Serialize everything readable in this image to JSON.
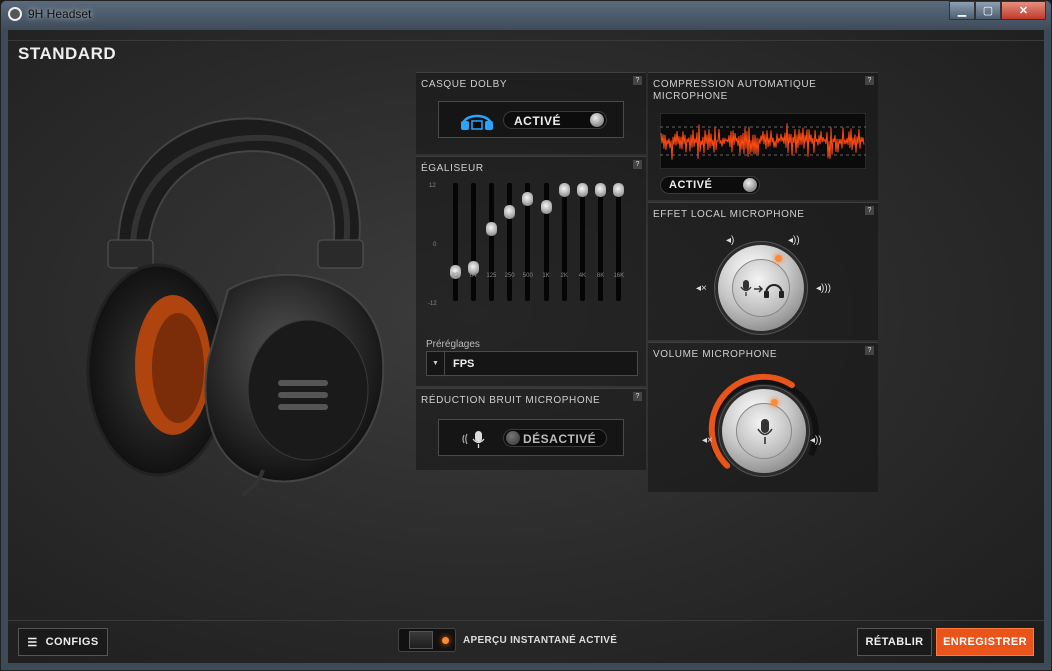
{
  "window": {
    "title": "9H Headset",
    "min_label": "▁",
    "max_label": "▢",
    "close_label": "✕"
  },
  "page": {
    "title": "STANDARD"
  },
  "dolby": {
    "title": "CASQUE DOLBY",
    "state": "ACTIVÉ",
    "help": "?"
  },
  "equalizer": {
    "title": "ÉGALISEUR",
    "help": "?",
    "scale_top": "12",
    "scale_mid": "0",
    "scale_bottom": "-12",
    "bands": [
      {
        "freq": "32",
        "gain_db": -7
      },
      {
        "freq": "64",
        "gain_db": -6
      },
      {
        "freq": "125",
        "gain_db": 3
      },
      {
        "freq": "250",
        "gain_db": 7
      },
      {
        "freq": "500",
        "gain_db": 10
      },
      {
        "freq": "1K",
        "gain_db": 8
      },
      {
        "freq": "2K",
        "gain_db": 13
      },
      {
        "freq": "4K",
        "gain_db": 13
      },
      {
        "freq": "8K",
        "gain_db": 13
      },
      {
        "freq": "16K",
        "gain_db": 13
      }
    ],
    "presets_label": "Préréglages",
    "preset_value": "FPS"
  },
  "noise_reduction": {
    "title": "RÉDUCTION BRUIT MICROPHONE",
    "state": "DÉSACTIVÉ",
    "help": "?"
  },
  "compression": {
    "title_line1": "COMPRESSION AUTOMATIQUE",
    "title_line2": "MICROPHONE",
    "state": "ACTIVÉ",
    "help": "?"
  },
  "sidetone": {
    "title": "EFFET LOCAL MICROPHONE",
    "help": "?"
  },
  "mic_volume": {
    "title": "VOLUME MICROPHONE",
    "help": "?",
    "level": 0.62
  },
  "bottom": {
    "configs_label": "CONFIGS",
    "preview_label": "APERÇU INSTANTANÉ ACTIVÉ",
    "reset_label": "RÉTABLIR",
    "save_label": "ENREGISTRER"
  },
  "colors": {
    "accent": "#e8541a",
    "waveform": "#ff4a12"
  }
}
